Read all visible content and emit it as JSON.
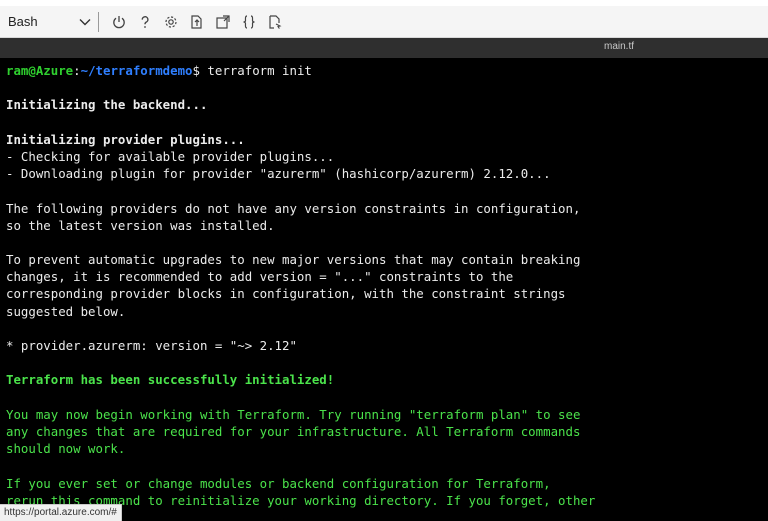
{
  "toolbar": {
    "shell": "Bash",
    "icons": [
      "chevron-down-icon",
      "power-icon",
      "help-icon",
      "settings-icon",
      "upload-download-icon",
      "open-session-icon",
      "braces-icon",
      "web-preview-icon"
    ]
  },
  "editor_tab": {
    "title": "main.tf"
  },
  "terminal": {
    "prompt_user": "ram@Azure",
    "prompt_colon": ":",
    "prompt_path": "~/terraformdemo",
    "prompt_suffix": "$ terraform init",
    "lines": [
      "",
      "Initializing the backend...",
      "",
      "Initializing provider plugins...",
      "- Checking for available provider plugins...",
      "- Downloading plugin for provider \"azurerm\" (hashicorp/azurerm) 2.12.0...",
      "",
      "The following providers do not have any version constraints in configuration,",
      "so the latest version was installed.",
      "",
      "To prevent automatic upgrades to new major versions that may contain breaking",
      "changes, it is recommended to add version = \"...\" constraints to the",
      "corresponding provider blocks in configuration, with the constraint strings",
      "suggested below.",
      "",
      "* provider.azurerm: version = \"~> 2.12\"",
      "",
      "Terraform has been successfully initialized!",
      "",
      "You may now begin working with Terraform. Try running \"terraform plan\" to see",
      "any changes that are required for your infrastructure. All Terraform commands",
      "should now work.",
      "",
      "If you ever set or change modules or backend configuration for Terraform,",
      "rerun this command to reinitialize your working directory. If you forget, other"
    ]
  },
  "status_url": "https://portal.azure.com/#"
}
